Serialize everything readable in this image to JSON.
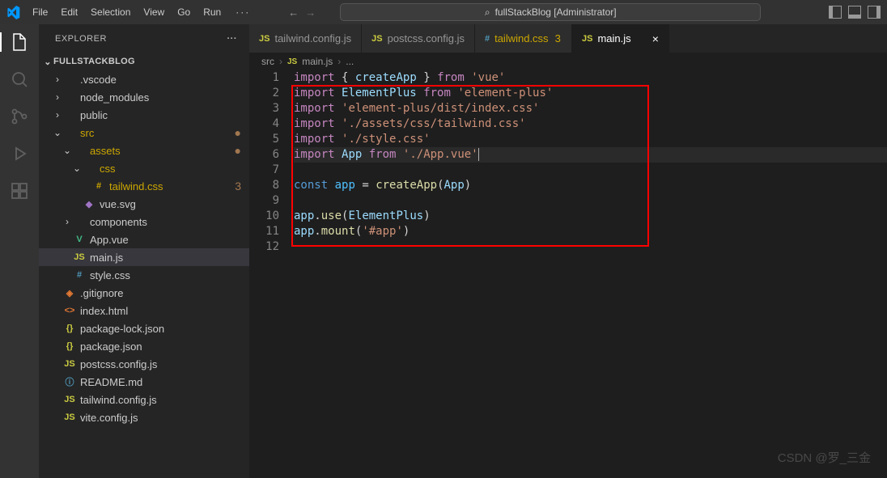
{
  "menu": {
    "items": [
      "File",
      "Edit",
      "Selection",
      "View",
      "Go",
      "Run"
    ],
    "more": "···"
  },
  "search": {
    "text": "fullStackBlog [Administrator]"
  },
  "sidebarTitle": "EXPLORER",
  "projectTitle": "FULLSTACKBLOG",
  "tree": [
    {
      "d": 1,
      "c": ">",
      "i": "",
      "cl": "",
      "n": ".vscode",
      "dot": ""
    },
    {
      "d": 1,
      "c": ">",
      "i": "",
      "cl": "",
      "n": "node_modules",
      "dot": ""
    },
    {
      "d": 1,
      "c": ">",
      "i": "",
      "cl": "",
      "n": "public",
      "dot": ""
    },
    {
      "d": 1,
      "c": "v",
      "i": "",
      "cl": "yellow",
      "n": "src",
      "dot": "●"
    },
    {
      "d": 2,
      "c": "v",
      "i": "",
      "cl": "yellow",
      "n": "assets",
      "dot": "●"
    },
    {
      "d": 3,
      "c": "v",
      "i": "",
      "cl": "yellow",
      "n": "css",
      "dot": ""
    },
    {
      "d": 4,
      "c": "",
      "i": "#",
      "cl": "yellow",
      "n": "tailwind.css",
      "dot": "3"
    },
    {
      "d": 3,
      "c": "",
      "i": "◆",
      "cl": "fc-svg",
      "n": "vue.svg",
      "dot": ""
    },
    {
      "d": 2,
      "c": ">",
      "i": "",
      "cl": "",
      "n": "components",
      "dot": ""
    },
    {
      "d": 2,
      "c": "",
      "i": "V",
      "cl": "fc-vue",
      "n": "App.vue",
      "dot": ""
    },
    {
      "d": 2,
      "c": "",
      "i": "JS",
      "cl": "fc-js",
      "n": "main.js",
      "dot": "",
      "active": true
    },
    {
      "d": 2,
      "c": "",
      "i": "#",
      "cl": "fc-hash",
      "n": "style.css",
      "dot": ""
    },
    {
      "d": 1,
      "c": "",
      "i": "◈",
      "cl": "fc-git",
      "n": ".gitignore",
      "dot": ""
    },
    {
      "d": 1,
      "c": "",
      "i": "<>",
      "cl": "fc-html",
      "n": "index.html",
      "dot": ""
    },
    {
      "d": 1,
      "c": "",
      "i": "{}",
      "cl": "fc-json",
      "n": "package-lock.json",
      "dot": ""
    },
    {
      "d": 1,
      "c": "",
      "i": "{}",
      "cl": "fc-json",
      "n": "package.json",
      "dot": ""
    },
    {
      "d": 1,
      "c": "",
      "i": "JS",
      "cl": "fc-js",
      "n": "postcss.config.js",
      "dot": ""
    },
    {
      "d": 1,
      "c": "",
      "i": "ⓘ",
      "cl": "fc-md",
      "n": "README.md",
      "dot": ""
    },
    {
      "d": 1,
      "c": "",
      "i": "JS",
      "cl": "fc-js",
      "n": "tailwind.config.js",
      "dot": ""
    },
    {
      "d": 1,
      "c": "",
      "i": "JS",
      "cl": "fc-js",
      "n": "vite.config.js",
      "dot": ""
    }
  ],
  "tabs": [
    {
      "i": "JS",
      "cl": "fc-js",
      "n": "tailwind.config.js",
      "active": false,
      "m": "",
      "close": ""
    },
    {
      "i": "JS",
      "cl": "fc-js",
      "n": "postcss.config.js",
      "active": false,
      "m": "",
      "close": ""
    },
    {
      "i": "#",
      "cl": "fc-hash",
      "n": "tailwind.css",
      "active": false,
      "m": "3",
      "close": "",
      "yellow": true
    },
    {
      "i": "JS",
      "cl": "fc-js",
      "n": "main.js",
      "active": true,
      "m": "",
      "close": "×"
    }
  ],
  "breadcrumb": {
    "parts": [
      "src",
      "main.js",
      "..."
    ],
    "i": "JS"
  },
  "lineCount": 12,
  "code": [
    "<span class='k-import'>import</span> <span class='pn'>{</span> <span class='var'>createApp</span> <span class='pn'>}</span> <span class='k-from'>from</span> <span class='str'>'vue'</span>",
    "<span class='k-import'>import</span> <span class='var'>ElementPlus</span> <span class='k-from'>from</span> <span class='str'>'element-plus'</span>",
    "<span class='k-import'>import</span> <span class='str'>'element-plus/dist/index.css'</span>",
    "<span class='k-import'>import</span> <span class='str'>'./assets/css/tailwind.css'</span>",
    "<span class='k-import'>import</span> <span class='str'>'./style.css'</span>",
    "<span class='k-import'>import</span> <span class='var'>App</span> <span class='k-from'>from</span> <span class='str'>'./App.vue'</span><span class='cursor'></span>",
    "",
    "<span class='k-const'>const</span> <span class='id'>app</span> <span class='pn'>=</span> <span class='fn'>createApp</span><span class='pn'>(</span><span class='var'>App</span><span class='pn'>)</span>",
    "",
    "<span class='var'>app</span><span class='pn'>.</span><span class='fn'>use</span><span class='pn'>(</span><span class='var'>ElementPlus</span><span class='pn'>)</span>",
    "<span class='var'>app</span><span class='pn'>.</span><span class='fn'>mount</span><span class='pn'>(</span><span class='str'>'#app'</span><span class='pn'>)</span>",
    ""
  ],
  "watermark": "CSDN @罗_三金"
}
